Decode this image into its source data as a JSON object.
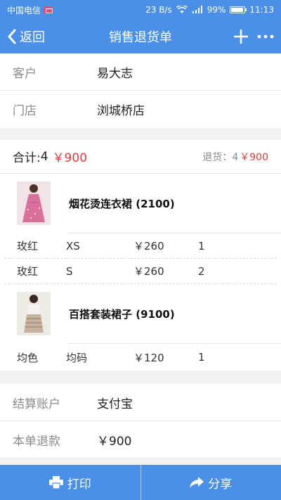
{
  "status_bar": {
    "carrier": "中国电信",
    "speed": "23 B/s",
    "network": "4G",
    "battery": "99%",
    "time": "11:13"
  },
  "nav": {
    "back_label": "返回",
    "title": "销售退货单"
  },
  "info": {
    "customer_label": "客户",
    "customer_value": "易大志",
    "store_label": "门店",
    "store_value": "浏城桥店"
  },
  "summary": {
    "total_label": "合计:",
    "total_count": "4",
    "total_amount": "￥900",
    "return_label": "退货：4",
    "return_amount": "￥900"
  },
  "products": [
    {
      "name": "烟花烫连衣裙 (2100)",
      "thumb_color": "#d87aa0",
      "specs": [
        {
          "color": "玫红",
          "size": "XS",
          "price": "￥260",
          "qty": "1"
        },
        {
          "color": "玫红",
          "size": "S",
          "price": "￥260",
          "qty": "2"
        }
      ]
    },
    {
      "name": "百搭套装裙子 (9100)",
      "thumb_color": "#c9b9a8",
      "specs": [
        {
          "color": "均色",
          "size": "均码",
          "price": "￥120",
          "qty": "1"
        }
      ]
    }
  ],
  "settlement": {
    "account_label": "结算账户",
    "account_value": "支付宝",
    "refund_label": "本单退款",
    "refund_value": "￥900"
  },
  "footer": {
    "print_label": "打印",
    "share_label": "分享"
  },
  "colors": {
    "accent": "#4a90e8",
    "price_red": "#e03a3a"
  }
}
